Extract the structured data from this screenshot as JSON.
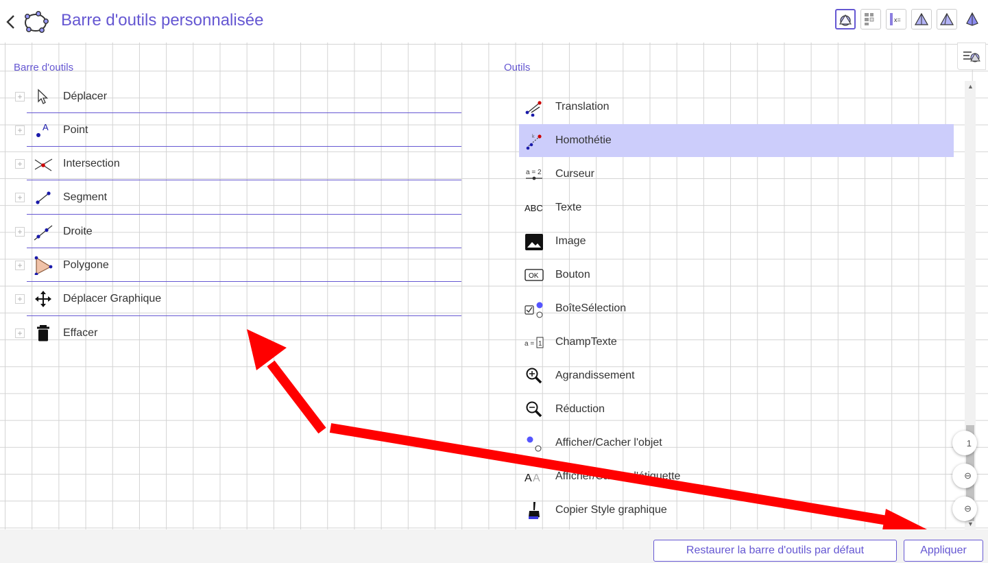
{
  "header": {
    "title": "Barre d'outils personnalisée"
  },
  "toolbar_section": {
    "title": "Barre d'outils",
    "items": [
      {
        "label": "Déplacer",
        "icon": "move-arrow-icon"
      },
      {
        "label": "Point",
        "icon": "point-icon"
      },
      {
        "label": "Intersection",
        "icon": "intersection-icon"
      },
      {
        "label": "Segment",
        "icon": "segment-icon"
      },
      {
        "label": "Droite",
        "icon": "line-icon"
      },
      {
        "label": "Polygone",
        "icon": "polygon-icon"
      },
      {
        "label": "Déplacer Graphique",
        "icon": "move-graphics-icon"
      },
      {
        "label": "Effacer",
        "icon": "delete-icon"
      }
    ],
    "expand_symbol": "+"
  },
  "tools_section": {
    "title": "Outils",
    "items": [
      {
        "label": "Translation",
        "icon": "translation-icon"
      },
      {
        "label": "Homothétie",
        "icon": "dilation-icon",
        "selected": true
      },
      {
        "label": "Curseur",
        "icon": "slider-icon",
        "icon_text": "a = 2"
      },
      {
        "label": "Texte",
        "icon": "text-icon",
        "icon_text": "ABC"
      },
      {
        "label": "Image",
        "icon": "image-icon"
      },
      {
        "label": "Bouton",
        "icon": "button-icon",
        "icon_text": "OK"
      },
      {
        "label": "BoîteSélection",
        "icon": "checkbox-icon"
      },
      {
        "label": "ChampTexte",
        "icon": "input-box-icon",
        "icon_text": "a =",
        "icon_value": "1"
      },
      {
        "label": "Agrandissement",
        "icon": "zoom-in-icon"
      },
      {
        "label": "Réduction",
        "icon": "zoom-out-icon"
      },
      {
        "label": "Afficher/Cacher l'objet",
        "icon": "show-hide-object-icon"
      },
      {
        "label": "Afficher/Cacher l'étiquette",
        "icon": "show-hide-label-icon",
        "icon_text": "AA"
      },
      {
        "label": "Copier Style graphique",
        "icon": "copy-visual-style-icon"
      }
    ]
  },
  "scroll": {
    "position_fraction": 0.95
  },
  "zoom_buttons": [
    "1",
    "⊖",
    "⊖"
  ],
  "footer": {
    "reset_label": "Restaurer la barre d'outils par défaut",
    "apply_label": "Appliquer"
  },
  "colors": {
    "accent": "#6557d2",
    "selected_row": "#cccdfb",
    "annotation_arrow": "#ff0000",
    "point_blue": "#1a1aaa",
    "point_red": "#cc0000"
  }
}
